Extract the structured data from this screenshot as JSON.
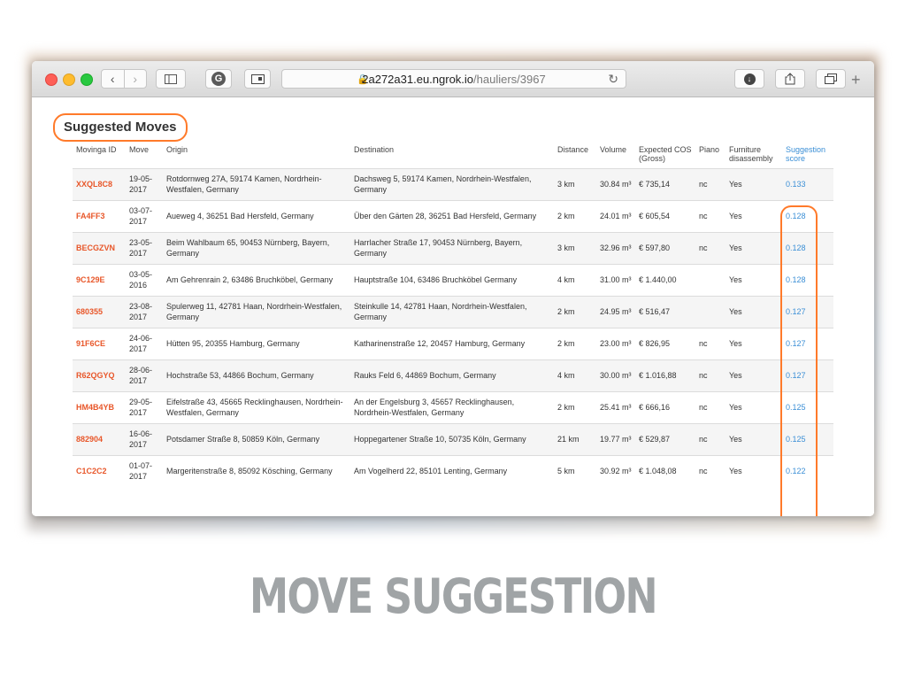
{
  "browser": {
    "url_host": "2a272a31.eu.ngrok.io",
    "url_path": "/hauliers/3967",
    "icons": [
      "back-icon",
      "forward-icon",
      "sidebar-icon",
      "grammarly-icon",
      "reader-icon",
      "lock-icon",
      "reload-icon",
      "download-icon",
      "share-icon",
      "tabs-icon",
      "new-tab-icon"
    ],
    "grammarly_label": "G",
    "new_tab_label": "+"
  },
  "section": {
    "title": "Suggested Moves"
  },
  "table": {
    "headers": [
      "Movinga ID",
      "Move",
      "Origin",
      "Destination",
      "Distance",
      "Volume",
      "Expected COS (Gross)",
      "Piano",
      "Furniture disassembly",
      "Suggestion score"
    ],
    "rows": [
      {
        "id": "XXQL8C8",
        "move": "19-05-2017",
        "origin": "Rotdornweg 27A, 59174 Kamen, Nordrhein-Westfalen, Germany",
        "destination": "Dachsweg 5, 59174 Kamen, Nordrhein-Westfalen, Germany",
        "distance": "3 km",
        "volume": "30.84 m³",
        "cos": "€ 735,14",
        "piano": "nc",
        "furniture": "Yes",
        "score": "0.133"
      },
      {
        "id": "FA4FF3",
        "move": "03-07-2017",
        "origin": "Aueweg 4, 36251 Bad Hersfeld, Germany",
        "destination": "Über den Gärten 28, 36251 Bad Hersfeld, Germany",
        "distance": "2 km",
        "volume": "24.01 m³",
        "cos": "€ 605,54",
        "piano": "nc",
        "furniture": "Yes",
        "score": "0.128"
      },
      {
        "id": "BECGZVN",
        "move": "23-05-2017",
        "origin": "Beim Wahlbaum 65, 90453 Nürnberg, Bayern, Germany",
        "destination": "Harrlacher Straße 17, 90453 Nürnberg, Bayern, Germany",
        "distance": "3 km",
        "volume": "32.96 m³",
        "cos": "€ 597,80",
        "piano": "nc",
        "furniture": "Yes",
        "score": "0.128"
      },
      {
        "id": "9C129E",
        "move": "03-05-2016",
        "origin": "Am Gehrenrain 2, 63486 Bruchköbel, Germany",
        "destination": "Hauptstraße 104, 63486 Bruchköbel Germany",
        "distance": "4 km",
        "volume": "31.00 m³",
        "cos": "€ 1.440,00",
        "piano": "",
        "furniture": "Yes",
        "score": "0.128"
      },
      {
        "id": "680355",
        "move": "23-08-2017",
        "origin": "Spulerweg 11, 42781 Haan, Nordrhein-Westfalen, Germany",
        "destination": "Steinkulle 14, 42781 Haan, Nordrhein-Westfalen, Germany",
        "distance": "2 km",
        "volume": "24.95 m³",
        "cos": "€ 516,47",
        "piano": "",
        "furniture": "Yes",
        "score": "0.127"
      },
      {
        "id": "91F6CE",
        "move": "24-06-2017",
        "origin": "Hütten 95, 20355 Hamburg, Germany",
        "destination": "Katharinenstraße 12, 20457 Hamburg, Germany",
        "distance": "2 km",
        "volume": "23.00 m³",
        "cos": "€ 826,95",
        "piano": "nc",
        "furniture": "Yes",
        "score": "0.127"
      },
      {
        "id": "R62QGYQ",
        "move": "28-06-2017",
        "origin": "Hochstraße 53, 44866 Bochum, Germany",
        "destination": "Rauks Feld 6, 44869 Bochum, Germany",
        "distance": "4 km",
        "volume": "30.00 m³",
        "cos": "€ 1.016,88",
        "piano": "nc",
        "furniture": "Yes",
        "score": "0.127"
      },
      {
        "id": "HM4B4YB",
        "move": "29-05-2017",
        "origin": "Eifelstraße 43, 45665 Recklinghausen, Nordrhein-Westfalen, Germany",
        "destination": "An der Engelsburg 3, 45657 Recklinghausen, Nordrhein-Westfalen, Germany",
        "distance": "2 km",
        "volume": "25.41 m³",
        "cos": "€ 666,16",
        "piano": "nc",
        "furniture": "Yes",
        "score": "0.125"
      },
      {
        "id": "882904",
        "move": "16-06-2017",
        "origin": "Potsdamer Straße 8, 50859 Köln, Germany",
        "destination": "Hoppegartener Straße 10, 50735 Köln, Germany",
        "distance": "21 km",
        "volume": "19.77 m³",
        "cos": "€ 529,87",
        "piano": "nc",
        "furniture": "Yes",
        "score": "0.125"
      },
      {
        "id": "C1C2C2",
        "move": "01-07-2017",
        "origin": "Margeritenstraße 8, 85092 Kösching, Germany",
        "destination": "Am Vogelherd 22, 85101 Lenting, Germany",
        "distance": "5 km",
        "volume": "30.92 m³",
        "cos": "€ 1.048,08",
        "piano": "nc",
        "furniture": "Yes",
        "score": "0.122"
      }
    ]
  },
  "slide": {
    "caption": "MOVE SUGGESTION"
  },
  "colors": {
    "accent": "#ff7a2a",
    "id_color": "#e8572a",
    "score_color": "#3b8fd6"
  }
}
